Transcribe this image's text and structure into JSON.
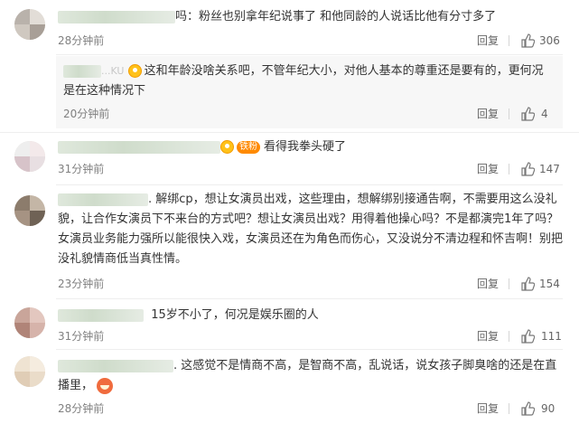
{
  "actions": {
    "reply_label": "回复"
  },
  "colors": {
    "accent": "#ff8a00",
    "muted": "#808080",
    "sub_bg": "#f7f7f7"
  },
  "comments": [
    {
      "text": "粉丝也别拿年纪说事了 和他同龄的人说话比他有分寸多了",
      "prefix_punct": "吗：",
      "time": "28分钟前",
      "likes": "306"
    },
    {
      "text_line1": "这和年龄没啥关系吧，不管年纪大小，对他人基本的尊重还是要有的，更何况",
      "text_line2": "是在这种情况下",
      "name_tail": "...KU",
      "time": "20分钟前",
      "likes": "4"
    },
    {
      "badge": "铁粉",
      "text": "看得我拳头硬了",
      "time": "31分钟前",
      "likes": "147"
    },
    {
      "line1": "解绑cp，想让女演员出戏，这些理由，想解绑别接通告啊，不需要用这么没礼",
      "line2": "貌，让合作女演员下不来台的方式吧？想让女演员出戏？用得着他操心吗？不是都演完1年了吗？",
      "line3": "女演员业务能力强所以能很快入戏，女演员还在为角色而伤心，又没说分不清边程和怀吉啊！别把",
      "line4": "没礼貌情商低当真性情。",
      "time": "23分钟前",
      "likes": "154"
    },
    {
      "text": "15岁不小了，何况是娱乐圈的人",
      "time": "31分钟前",
      "likes": "111"
    },
    {
      "line1": "这感觉不是情商不高，是智商不高，乱说话，说女孩子脚臭啥的还是在直",
      "line2": "播里，",
      "time": "28分钟前",
      "likes": "90"
    }
  ]
}
